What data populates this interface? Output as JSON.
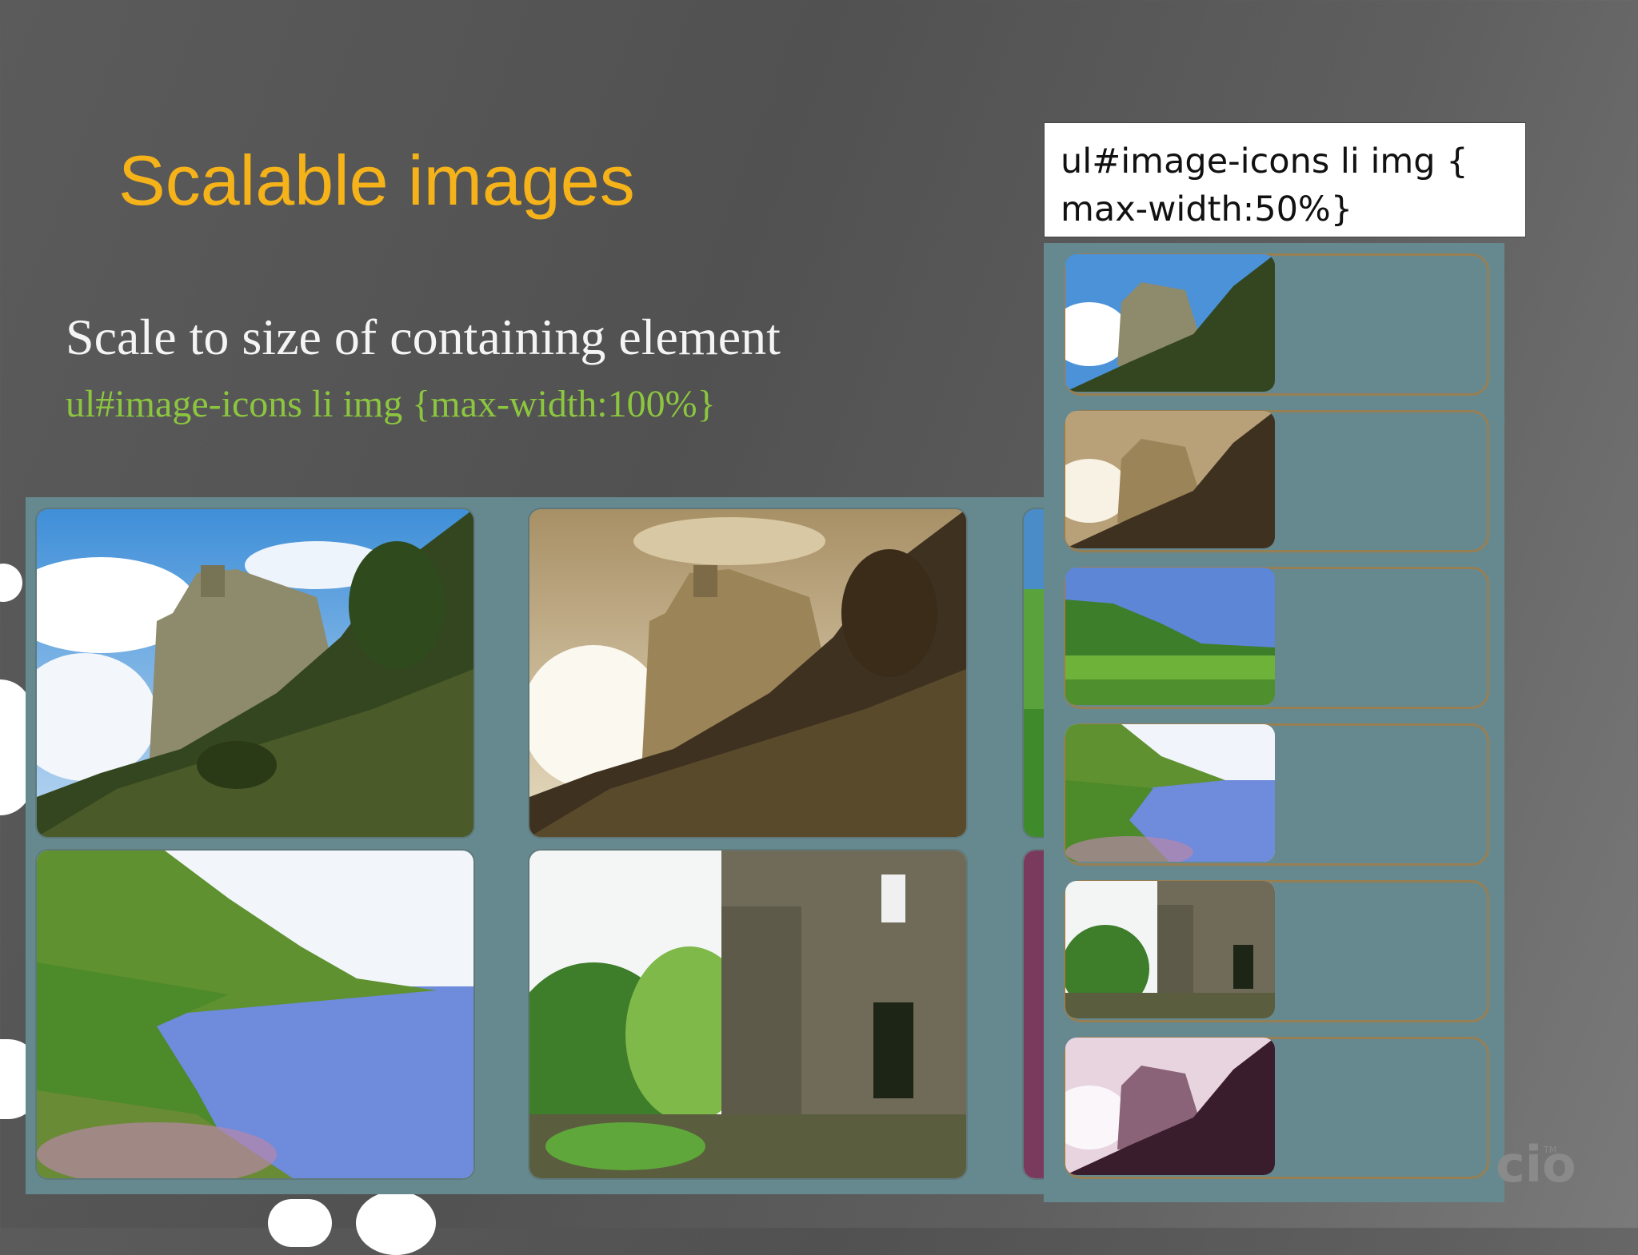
{
  "slide": {
    "title": "Scalable images",
    "subtitle": "Scale to size of containing element",
    "code_example": "ul#image-icons li img {max-width:100%}"
  },
  "code_box": {
    "line1": "ul#image-icons li img {",
    "line2": "max-width:50%}"
  },
  "gallery": {
    "images": [
      "castle-photo",
      "castle-sepia-photo",
      "coast-photo",
      "coast-hillside-photo",
      "castle-ruin-photo",
      "castle-purple-photo"
    ]
  },
  "logo": {
    "text": "cio",
    "tm": "TM"
  },
  "colors": {
    "title": "#f5b219",
    "code_green": "#8cc63f",
    "panel": "#668990",
    "frame": "#a07e4a"
  }
}
